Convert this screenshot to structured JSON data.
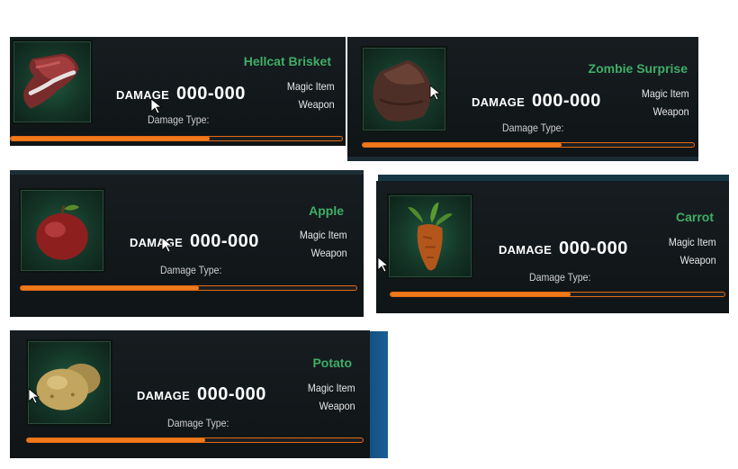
{
  "colors": {
    "panel_bg": "#12181b",
    "name_green": "#3fae67",
    "bar_orange": "#f07a1a",
    "text_white": "#ffffff"
  },
  "items": [
    {
      "name": "Hellcat Brisket",
      "damage_label": "DAMAGE",
      "damage_value": "000-000",
      "tag1": "Magic Item",
      "tag2": "Weapon",
      "damage_type_label": "Damage Type:",
      "bar_progress": 0.6,
      "icon": "meat-brisket-icon"
    },
    {
      "name": "Zombie Surprise",
      "damage_label": "DAMAGE",
      "damage_value": "000-000",
      "tag1": "Magic Item",
      "tag2": "Weapon",
      "damage_type_label": "Damage Type:",
      "bar_progress": 0.6,
      "icon": "zombie-rock-icon"
    },
    {
      "name": "Apple",
      "damage_label": "DAMAGE",
      "damage_value": "000-000",
      "tag1": "Magic Item",
      "tag2": "Weapon",
      "damage_type_label": "Damage Type:",
      "bar_progress": 0.53,
      "icon": "apple-icon"
    },
    {
      "name": "Carrot",
      "damage_label": "DAMAGE",
      "damage_value": "000-000",
      "tag1": "Magic Item",
      "tag2": "Weapon",
      "damage_type_label": "Damage Type:",
      "bar_progress": 0.54,
      "icon": "carrot-icon"
    },
    {
      "name": "Potato",
      "damage_label": "DAMAGE",
      "damage_value": "000-000",
      "tag1": "Magic Item",
      "tag2": "Weapon",
      "damage_type_label": "Damage Type:",
      "bar_progress": 0.53,
      "icon": "potato-icon"
    }
  ]
}
